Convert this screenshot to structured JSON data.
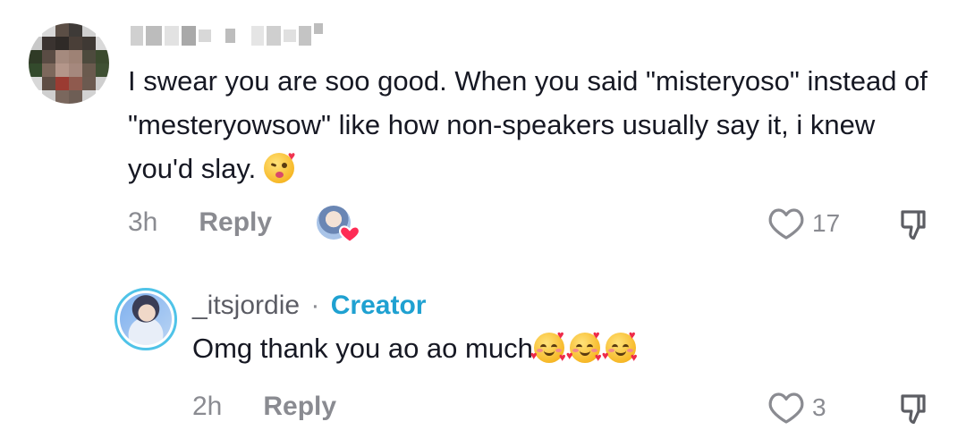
{
  "comment": {
    "text": "I swear you are soo good. When you said \"misteryoso\" instead of \"mesteryowsow\" like how non-speakers usually say it, i knew you'd slay.",
    "emoji": "face-blowing-kiss",
    "time": "3h",
    "reply_label": "Reply",
    "like_count": "17"
  },
  "reply": {
    "username": "_itsjordie",
    "separator": "·",
    "badge": "Creator",
    "text": "Omg thank you ao ao much",
    "emoji": "smiling-face-with-hearts",
    "time": "2h",
    "reply_label": "Reply",
    "like_count": "3"
  },
  "colors": {
    "creator_accent": "#1fa1d1",
    "muted_text": "#8a8b91",
    "body_text": "#161823",
    "liked_heart": "#fe2c55"
  }
}
